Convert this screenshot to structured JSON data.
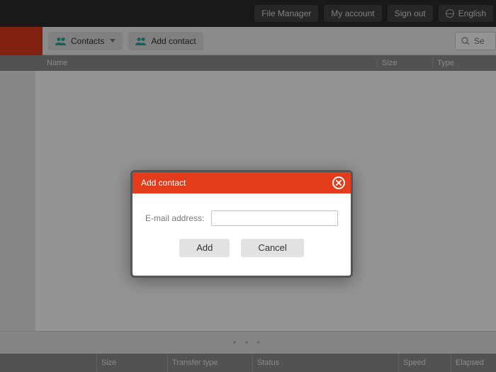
{
  "topbar": {
    "file_manager": "File Manager",
    "my_account": "My account",
    "sign_out": "Sign out",
    "language": "English"
  },
  "toolbar": {
    "contacts": "Contacts",
    "add_contact": "Add contact",
    "search_placeholder": "Se"
  },
  "table": {
    "name": "Name",
    "size": "Size",
    "type": "Type"
  },
  "transfer": {
    "size": "Size",
    "transfer_type": "Transfer type",
    "status": "Status",
    "speed": "Speed",
    "elapsed": "Elapsed"
  },
  "modal": {
    "title": "Add contact",
    "email_label": "E-mail address:",
    "email_value": "",
    "add": "Add",
    "cancel": "Cancel"
  }
}
